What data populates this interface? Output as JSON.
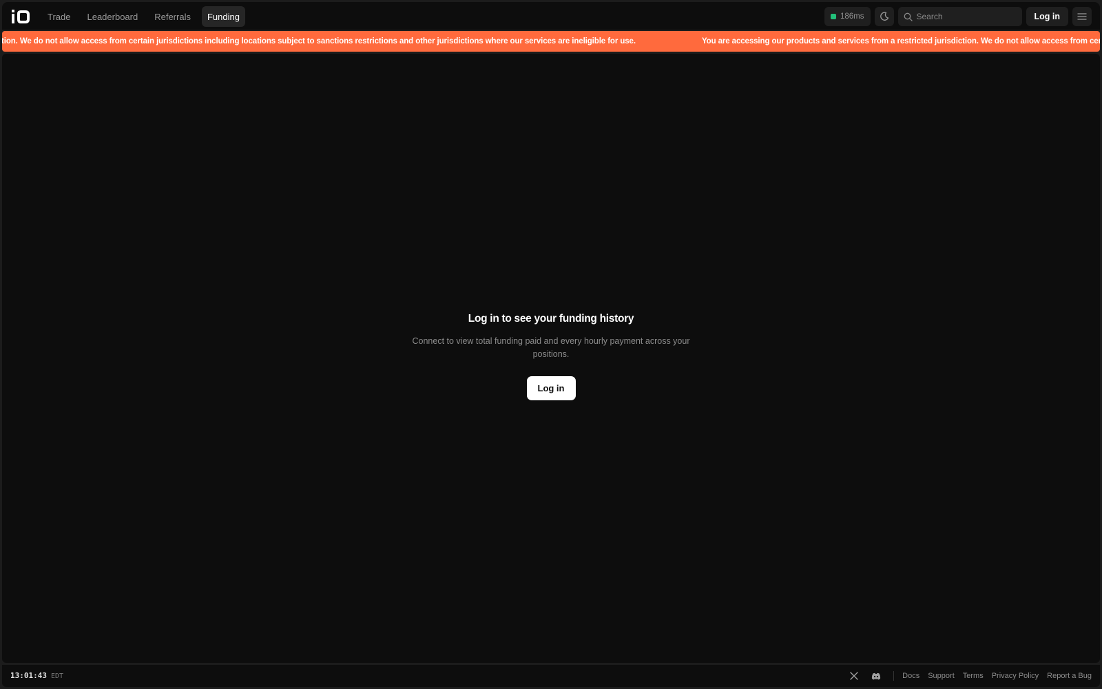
{
  "header": {
    "nav": [
      {
        "label": "Trade",
        "active": false
      },
      {
        "label": "Leaderboard",
        "active": false
      },
      {
        "label": "Referrals",
        "active": false
      },
      {
        "label": "Funding",
        "active": true
      }
    ],
    "latency": "186ms",
    "search_placeholder": "Search",
    "login_label": "Log in",
    "icons": {
      "logo": "io-logo",
      "latency_status": "status-dot",
      "theme": "moon-icon",
      "search": "search-icon",
      "menu": "hamburger-icon"
    }
  },
  "banner": {
    "visible_start": "tion. We do not allow access from certain jurisdictions including locations subject to sanctions restrictions and other jurisdictions where our services are ineligible for use.",
    "message": "You are accessing our products and services from a restricted jurisdiction. We do not allow access from certain jurisdictions including locations subject to sanctions restrictions and other jurisdictions where our services are ineligible for use."
  },
  "main": {
    "title": "Log in to see your funding history",
    "description": "Connect to view total funding paid and every hourly payment across your positions.",
    "login_label": "Log in"
  },
  "footer": {
    "time": "13:01:43",
    "timezone": "EDT",
    "social_icons": [
      "x-icon",
      "discord-icon"
    ],
    "links": [
      "Docs",
      "Support",
      "Terms",
      "Privacy Policy",
      "Report a Bug"
    ]
  },
  "colors": {
    "banner": "#ff6a3d",
    "latency_dot": "#22c07a",
    "background": "#0d0d0d",
    "nav_active_bg": "#262626"
  }
}
